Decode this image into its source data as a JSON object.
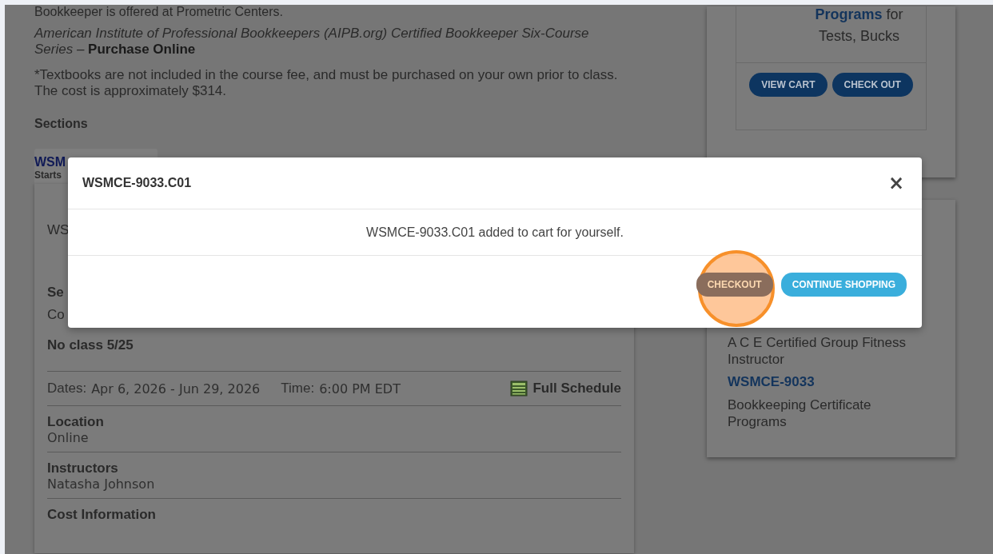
{
  "page": {
    "intro_cut": "Bookkeeper is offered at Prometric Centers.",
    "series_text": "American Institute of Professional Bookkeepers (AIPB.org) Certified Bookkeeper Six-Course Series –",
    "series_link": "Purchase Online",
    "textbook_note": "*Textbooks are not included in the course fee, and must be purchased on your own prior to class. The cost is approximately $314.",
    "sections_heading": "Sections",
    "section_tab": {
      "code": "WSM",
      "starts": "Starts"
    },
    "section_card": {
      "code_fragment": "WS",
      "label_fragment": "Se",
      "text_fragment": "Co",
      "note": "No class 5/25",
      "dates_label": "Dates:",
      "dates": "Apr 6, 2026 - Jun 29, 2026",
      "time_label": "Time:",
      "time": "6:00 PM EDT",
      "schedule_link": "Full Schedule",
      "details": [
        {
          "label": "Location",
          "value": "Online"
        },
        {
          "label": "Instructors",
          "value": "Natasha Johnson"
        },
        {
          "label": "Cost Information"
        }
      ]
    }
  },
  "cart_panel": {
    "link": "Programs",
    "link_tail": "for",
    "text": "Tests, Bucks",
    "buttons": [
      "VIEW CART",
      "CHECK OUT"
    ]
  },
  "related": [
    {
      "kind": "text",
      "text": "A C E Certified Group Fitness Instructor"
    },
    {
      "kind": "link",
      "text": "WSMCE-9033"
    },
    {
      "kind": "text",
      "text": "Bookkeeping Certificate Programs"
    }
  ],
  "modal": {
    "title": "WSMCE-9033.C01",
    "close": "×",
    "message": "WSMCE-9033.C01 added to cart for yourself.",
    "buttons": [
      {
        "label": "CHECKOUT",
        "kind": "primary",
        "highlighted": true
      },
      {
        "label": "CONTINUE SHOPPING",
        "kind": "secondary",
        "highlighted": false
      }
    ]
  }
}
